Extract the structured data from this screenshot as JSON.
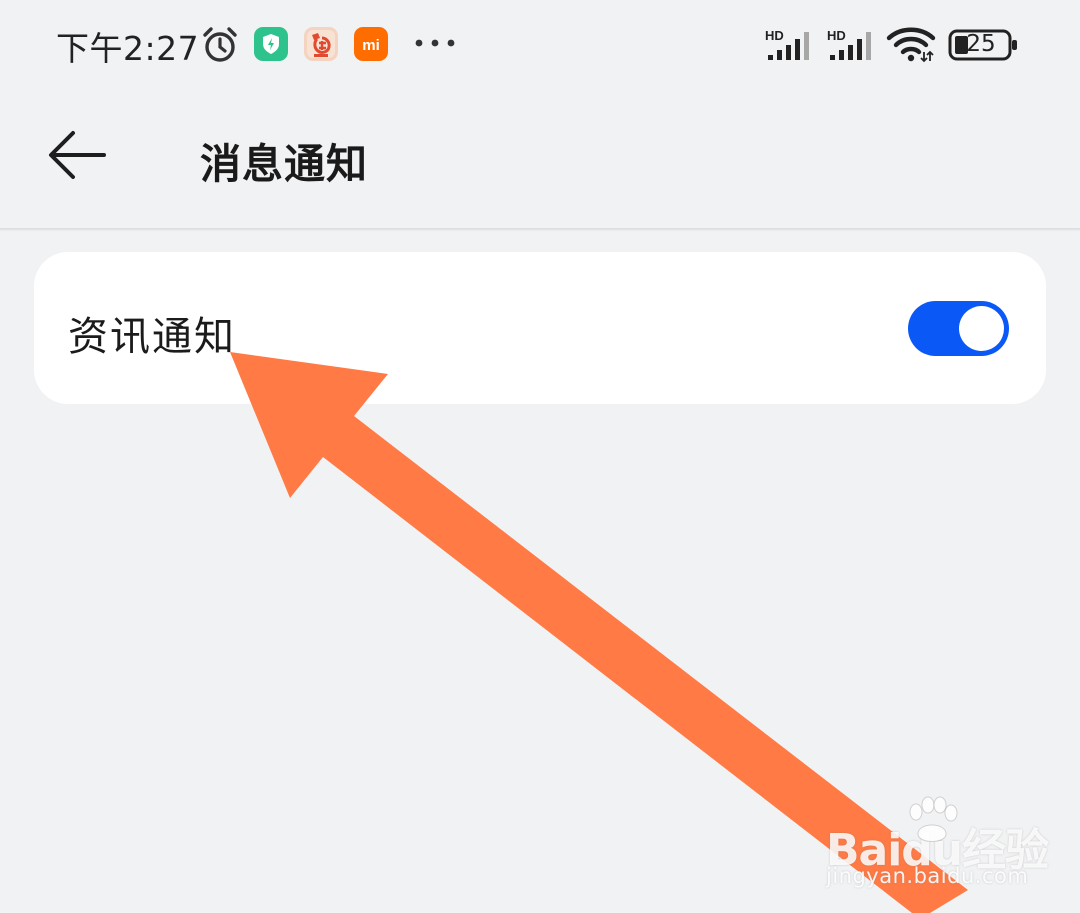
{
  "status_bar": {
    "time": "下午2:27",
    "icons": [
      "alarm-icon",
      "guard-app-icon",
      "shopping-app-icon",
      "mi-app-icon",
      "more-notifications-icon",
      "hd-signal-icon",
      "hd-signal-icon",
      "wifi-icon",
      "battery-icon"
    ],
    "signal_1_label": "HD",
    "signal_2_label": "HD",
    "mi_app_label": "mi",
    "battery_level": "25"
  },
  "header": {
    "title": "消息通知",
    "back_icon": "back-arrow-icon"
  },
  "settings": {
    "items": [
      {
        "label": "资讯通知",
        "toggle_state": "on"
      }
    ]
  },
  "annotation": {
    "arrow_color": "#ff7a45"
  },
  "watermark": {
    "brand_text": "Baidu经验",
    "sub_text": "jingyan.baidu.com"
  },
  "colors": {
    "background": "#f1f2f4",
    "card": "#ffffff",
    "toggle_accent": "#0a59f7"
  }
}
